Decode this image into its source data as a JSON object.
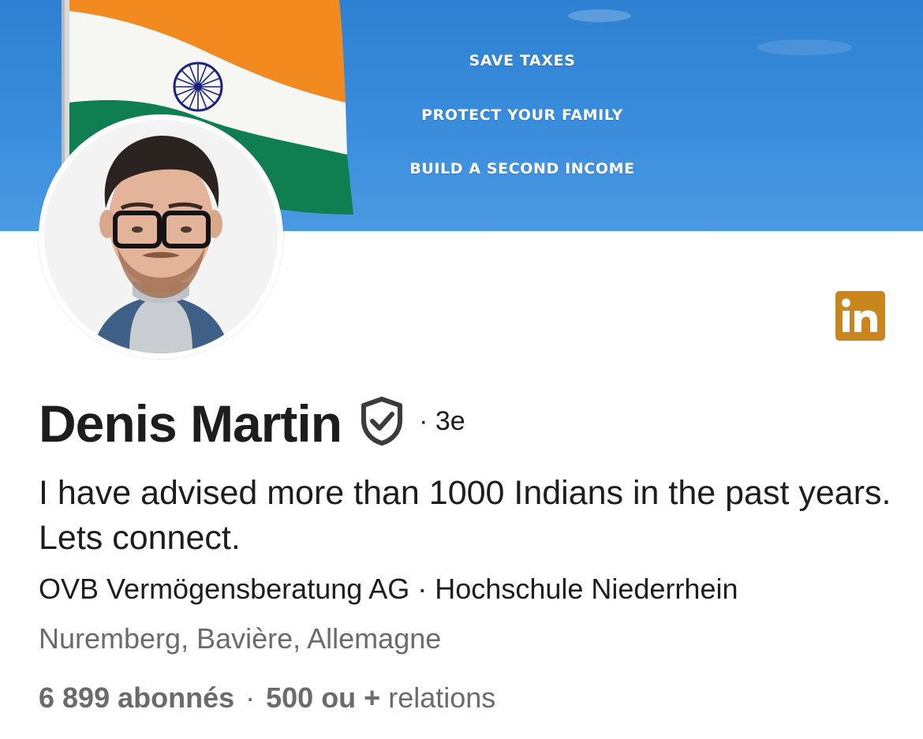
{
  "banner": {
    "lines": [
      "SAVE TAXES",
      "PROTECT YOUR FAMILY",
      "BUILD A SECOND INCOME"
    ],
    "sky_color": "#3a8ddc",
    "flag_colors": {
      "saffron": "#f28a1f",
      "white": "#f6f6f2",
      "green": "#0f7f52",
      "chakra": "#1a237e"
    }
  },
  "profile": {
    "name": "Denis Martin",
    "degree": "· 3e",
    "headline": "I have advised more than 1000 Indians in the past years. Lets connect.",
    "organizations": "OVB Vermögensberatung AG · Hochschule Niederrhein",
    "location": "Nuremberg, Bavière, Allemagne"
  },
  "stats": {
    "followers": "6 899 abonnés",
    "separator": "·",
    "connections_count": "500 ou +",
    "connections_label": "relations"
  },
  "icons": {
    "verified": "shield-check-icon",
    "linkedin": "linkedin-icon"
  },
  "colors": {
    "linkedin_badge": "#c8861c",
    "text_primary": "#1d1d1d",
    "text_secondary": "#6b6b6b"
  }
}
